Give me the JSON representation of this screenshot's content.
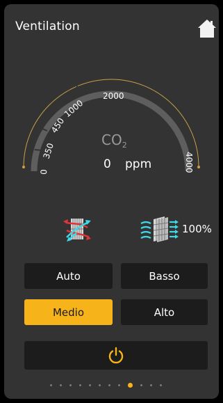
{
  "header": {
    "title": "Ventilation",
    "home_icon": "home-icon"
  },
  "gauge": {
    "tick_labels": [
      "0",
      "350",
      "450",
      "1000",
      "2000",
      "4000"
    ],
    "co2_main": "CO",
    "co2_sub": "2",
    "value": "0",
    "unit": "ppm"
  },
  "status": {
    "heat_recovery_icon": "heat-exchanger-icon",
    "fan_icon": "airflow-icon",
    "fan_percent": "100%"
  },
  "modes": [
    {
      "label": "Auto",
      "active": false
    },
    {
      "label": "Basso",
      "active": false
    },
    {
      "label": "Medio",
      "active": true
    },
    {
      "label": "Alto",
      "active": false
    }
  ],
  "power": {
    "icon": "power-icon"
  },
  "pagination": {
    "count": 12,
    "active_index": 8
  },
  "colors": {
    "accent": "#f6b31a",
    "panel": "#333333",
    "button": "#1c1c1c",
    "arc_red": "#e0343a",
    "arc_cyan": "#3dd9e8"
  }
}
